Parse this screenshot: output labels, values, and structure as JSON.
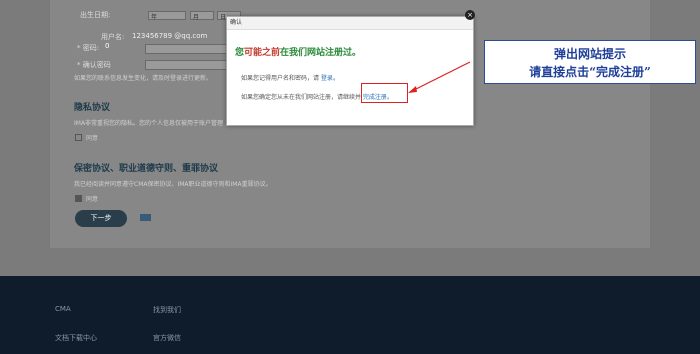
{
  "form": {
    "birth_label": "出生日期:",
    "year": "年",
    "month": "月",
    "day": "日",
    "username_label": "用户名:",
    "username_value": "123456789 @qq.com",
    "password_label": "* 密码:",
    "password_value": "0",
    "confirm_label": "* 确认密码",
    "hint": "如果您的联系信息发生变化，请及时登录进行更新。",
    "privacy_title": "隐私协议",
    "privacy_text": "IMA非常重视您的隐私。您的个人信息仅被用于账户管理",
    "privacy_agree": "同意",
    "confidential_title": "保密协议、职业道德守则、重罪协议",
    "confidential_text": "我已经阅读并同意遵守CMA保密协议、IMA职业道德守则和IMA重罪协议。",
    "confidential_agree": "同意",
    "next_button": "下一步"
  },
  "footer": {
    "col1_a": "CMA",
    "col1_b": "文档下载中心",
    "col2_a": "找到我们",
    "col2_b": "官方微信"
  },
  "modal": {
    "header": "确认",
    "title_pre": "您",
    "title_hl": "可能之前",
    "title_post": "在我们网站注册过。",
    "line1_pre": "如果您记得用户名和密码，请 ",
    "line1_link": "登录",
    "line1_post": "。",
    "line2_pre": "如果您确定您从未在我们网站注册，请继续并 ",
    "line2_link": "完成注册",
    "line2_post": "。",
    "close": "×"
  },
  "callout": {
    "line1": "弹出网站提示",
    "line2": "请直接点击“完成注册”"
  }
}
